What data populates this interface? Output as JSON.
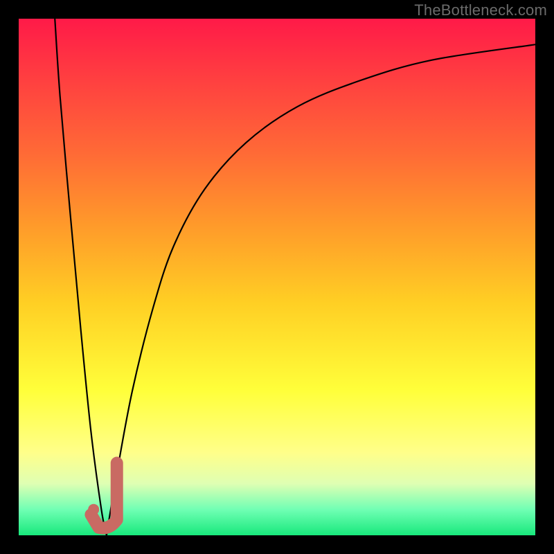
{
  "watermark": "TheBottleneck.com",
  "colors": {
    "curve_stroke": "#000000",
    "marker_stroke": "#c96a63",
    "marker_fill": "#c96a63"
  },
  "chart_data": {
    "type": "line",
    "title": "",
    "xlabel": "",
    "ylabel": "",
    "xlim": [
      0,
      100
    ],
    "ylim": [
      0,
      100
    ],
    "series": [
      {
        "name": "left-branch",
        "x": [
          7,
          8,
          10,
          12,
          14,
          16,
          17
        ],
        "values": [
          100,
          85,
          62,
          40,
          20,
          5,
          0
        ]
      },
      {
        "name": "right-branch",
        "x": [
          17,
          19,
          22,
          26,
          30,
          36,
          44,
          54,
          66,
          80,
          100
        ],
        "values": [
          0,
          12,
          28,
          44,
          56,
          67,
          76,
          83,
          88,
          92,
          95
        ]
      }
    ],
    "marker": {
      "name": "j-marker",
      "tip_x": 14.5,
      "tip_y": 5,
      "path": [
        {
          "x": 19,
          "y": 14
        },
        {
          "x": 19,
          "y": 3
        },
        {
          "x": 17.5,
          "y": 1
        },
        {
          "x": 15.5,
          "y": 1.5
        },
        {
          "x": 14,
          "y": 4
        }
      ]
    }
  }
}
